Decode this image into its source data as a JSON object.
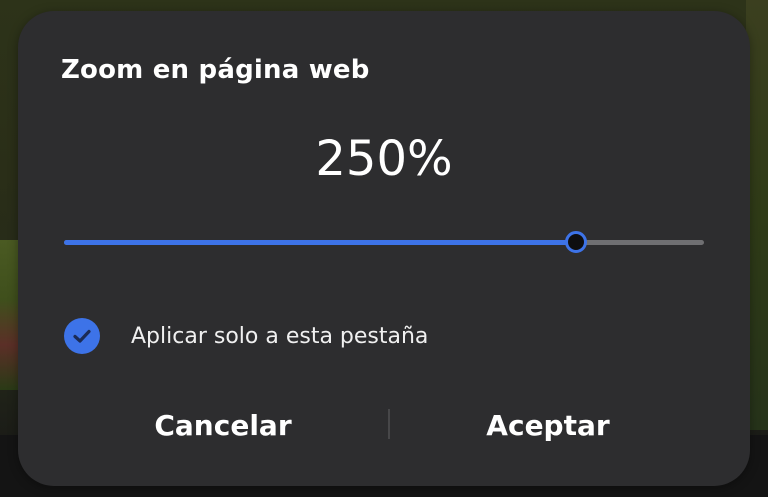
{
  "dialog": {
    "title": "Zoom en página web",
    "zoom_value_text": "250%",
    "slider": {
      "level_fraction": 0.8
    },
    "checkbox": {
      "checked": true,
      "label": "Aplicar solo a esta pestaña",
      "icon": "checkmark-icon"
    },
    "buttons": {
      "cancel_label": "Cancelar",
      "accept_label": "Aceptar"
    }
  },
  "colors": {
    "dialog_background": "#2d2d2f",
    "accent": "#3d73e8",
    "track_inactive": "#6f6f72",
    "text": "#ffffff"
  }
}
